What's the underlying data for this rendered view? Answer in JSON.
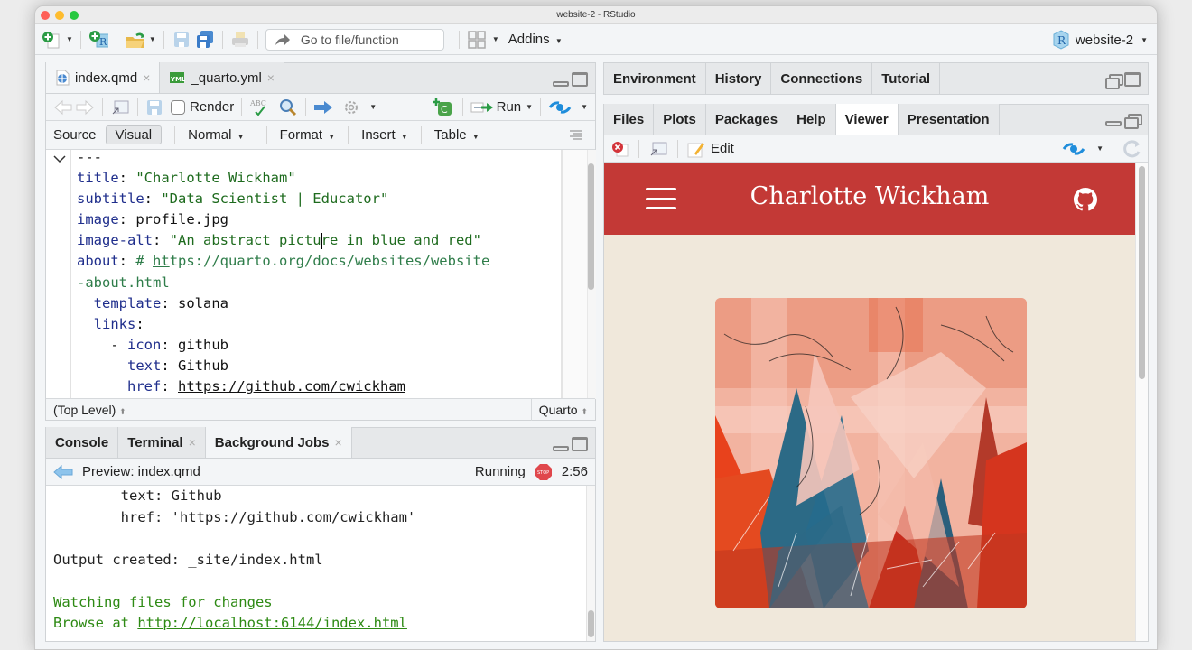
{
  "window": {
    "title": "website-2 - RStudio"
  },
  "main_toolbar": {
    "new_file_icon": "new-file-icon",
    "new_project_icon": "new-project-icon",
    "open_icon": "open-folder-icon",
    "save_icon": "save-icon",
    "save_all_icon": "save-all-icon",
    "print_icon": "print-icon",
    "goto_placeholder": "Go to file/function",
    "grid_icon": "pane-layout-icon",
    "addins_label": "Addins",
    "project_name": "website-2"
  },
  "source_pane": {
    "tabs": [
      {
        "label": "index.qmd",
        "icon": "quarto-file-icon",
        "active": true
      },
      {
        "label": "_quarto.yml",
        "icon": "yml-file-icon",
        "active": false
      }
    ],
    "toolbar": {
      "render_label": "Render",
      "run_label": "Run"
    },
    "mode_bar": {
      "source_label": "Source",
      "visual_label": "Visual",
      "style_label": "Normal",
      "format_label": "Format",
      "insert_label": "Insert",
      "table_label": "Table"
    },
    "code_lines": [
      [
        {
          "t": "---",
          "c": "v"
        }
      ],
      [
        {
          "t": "title",
          "c": "k"
        },
        {
          "t": ": ",
          "c": "v"
        },
        {
          "t": "\"Charlotte Wickham\"",
          "c": "s"
        }
      ],
      [
        {
          "t": "subtitle",
          "c": "k"
        },
        {
          "t": ": ",
          "c": "v"
        },
        {
          "t": "\"Data Scientist | Educator\"",
          "c": "s"
        }
      ],
      [
        {
          "t": "image",
          "c": "k"
        },
        {
          "t": ": profile.jpg",
          "c": "v"
        }
      ],
      [
        {
          "t": "image-alt",
          "c": "k"
        },
        {
          "t": ": ",
          "c": "v"
        },
        {
          "t": "\"An abstract pictu",
          "c": "s"
        },
        {
          "t": "|",
          "c": "cursor"
        },
        {
          "t": "re in blue and red\"",
          "c": "s"
        }
      ],
      [
        {
          "t": "about",
          "c": "k"
        },
        {
          "t": ": ",
          "c": "v"
        },
        {
          "t": "# ",
          "c": "c"
        },
        {
          "t": "ht",
          "c": "cu"
        },
        {
          "t": "tps://quarto.org/docs/websites/website",
          "c": "c"
        }
      ],
      [
        {
          "t": "-about.html",
          "c": "c"
        }
      ],
      [
        {
          "t": "  template",
          "c": "k"
        },
        {
          "t": ": solana",
          "c": "v"
        }
      ],
      [
        {
          "t": "  links",
          "c": "k"
        },
        {
          "t": ":",
          "c": "v"
        }
      ],
      [
        {
          "t": "    - ",
          "c": "v"
        },
        {
          "t": "icon",
          "c": "k"
        },
        {
          "t": ": github",
          "c": "v"
        }
      ],
      [
        {
          "t": "      text",
          "c": "k"
        },
        {
          "t": ": Github",
          "c": "v"
        }
      ],
      [
        {
          "t": "      href",
          "c": "k"
        },
        {
          "t": ": ",
          "c": "v"
        },
        {
          "t": "https://github.com/cwickham",
          "c": "vu"
        }
      ]
    ],
    "status": {
      "scope": "(Top Level)",
      "language": "Quarto"
    }
  },
  "console_pane": {
    "tabs": [
      {
        "label": "Console",
        "closable": false,
        "active": false
      },
      {
        "label": "Terminal",
        "closable": true,
        "active": false
      },
      {
        "label": "Background Jobs",
        "closable": true,
        "active": true
      }
    ],
    "job": {
      "name": "Preview: index.qmd",
      "status": "Running",
      "elapsed": "2:56"
    },
    "output_lines": [
      {
        "text": "        text: Github",
        "cls": ""
      },
      {
        "text": "        href: 'https://github.com/cwickham'",
        "cls": ""
      },
      {
        "text": "",
        "cls": ""
      },
      {
        "text": "Output created: _site/index.html",
        "cls": ""
      },
      {
        "text": "",
        "cls": ""
      },
      {
        "text": "Watching files for changes",
        "cls": "g"
      },
      {
        "text": "Browse at ",
        "cls": "g",
        "link": "http://localhost:6144/index.html"
      }
    ]
  },
  "env_pane": {
    "tabs": [
      "Environment",
      "History",
      "Connections",
      "Tutorial"
    ]
  },
  "files_pane": {
    "tabs": [
      {
        "label": "Files",
        "active": false
      },
      {
        "label": "Plots",
        "active": false
      },
      {
        "label": "Packages",
        "active": false
      },
      {
        "label": "Help",
        "active": false
      },
      {
        "label": "Viewer",
        "active": true
      },
      {
        "label": "Presentation",
        "active": false
      }
    ],
    "toolbar": {
      "edit_label": "Edit"
    }
  },
  "viewer": {
    "site_title": "Charlotte Wickham",
    "navbar_color": "#c33936",
    "page_bg": "#f0e8db",
    "image_alt": "An abstract picture in blue and red"
  }
}
